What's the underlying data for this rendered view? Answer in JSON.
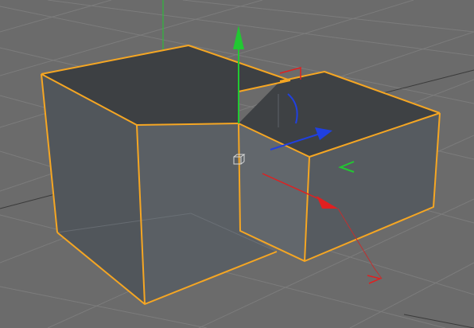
{
  "app": {
    "viewport_label": "",
    "view": "perspective",
    "selection_color": "#f5a623"
  },
  "scene": {
    "grid_visible": true,
    "grid_color": "#7a7a7a",
    "background_color": "#6b6b6b",
    "objects": [
      {
        "name": "cube-large",
        "selected": true
      },
      {
        "name": "cube-small",
        "selected": true
      }
    ],
    "manipulator": {
      "axis_colors": {
        "x": "#e02020",
        "y": "#22c832",
        "z": "#2040e0"
      },
      "scale_handle_color": "#22c832",
      "rotate_handle_color": "#e02020"
    },
    "pivot_icon": "pivot-cube-icon"
  }
}
